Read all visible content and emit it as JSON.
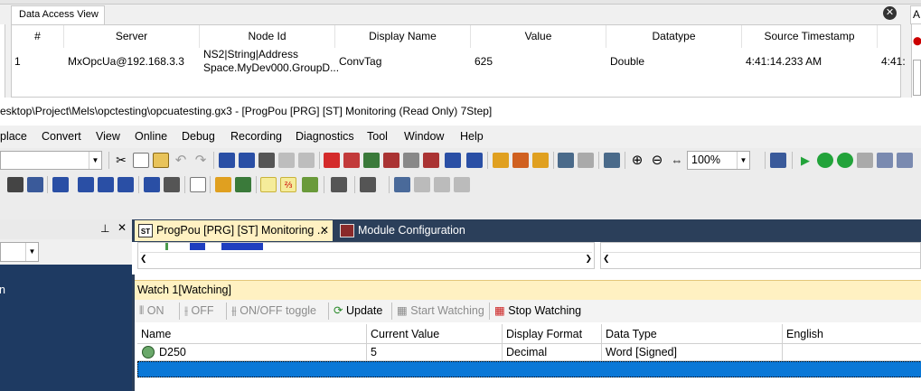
{
  "data_access_view": {
    "tab_label": "Data Access View",
    "right_tab_fragment": "A",
    "columns": [
      "#",
      "Server",
      "Node Id",
      "Display Name",
      "Value",
      "Datatype",
      "Source Timestamp"
    ],
    "rows": [
      {
        "index": "1",
        "server": "MxOpcUa@192.168.3.3",
        "node_id_line1": "NS2|String|Address",
        "node_id_line2": "Space.MyDev000.GroupD...",
        "display_name": "ConvTag",
        "value": "625",
        "datatype": "Double",
        "source_timestamp": "4:41:14.233 AM",
        "cutoff": "4:41:"
      }
    ]
  },
  "window": {
    "title": "esktop\\Project\\Mels\\opctesting\\opcuatesting.gx3 - [ProgPou [PRG] [ST] Monitoring (Read Only) 7Step]"
  },
  "menu": [
    "place",
    "Convert",
    "View",
    "Online",
    "Debug",
    "Recording",
    "Diagnostics",
    "Tool",
    "Window",
    "Help"
  ],
  "toolbar": {
    "zoom": "100%"
  },
  "doc_tabs": [
    {
      "icon": "ST",
      "label": "ProgPou [PRG] [ST] Monitoring ...",
      "active": true
    },
    {
      "label": "Module Configuration",
      "active": false
    }
  ],
  "watch": {
    "title": "Watch 1[Watching]",
    "buttons": {
      "on": "ON",
      "off": "OFF",
      "toggle": "ON/OFF toggle",
      "update": "Update",
      "start": "Start Watching",
      "stop": "Stop Watching"
    },
    "columns": [
      "Name",
      "Current Value",
      "Display Format",
      "Data Type",
      "English"
    ],
    "rows": [
      {
        "name": "D250",
        "current_value": "5",
        "display_format": "Decimal",
        "data_type": "Word [Signed]",
        "english": ""
      }
    ]
  },
  "left_dock": {
    "item_fragment": "n"
  },
  "colors": {
    "dock_blue": "#1e3a62",
    "tab_strip": "#2b3f5a",
    "watch_header": "#fff1c2",
    "selection": "#0a78d7",
    "run_green": "#22a33a"
  }
}
